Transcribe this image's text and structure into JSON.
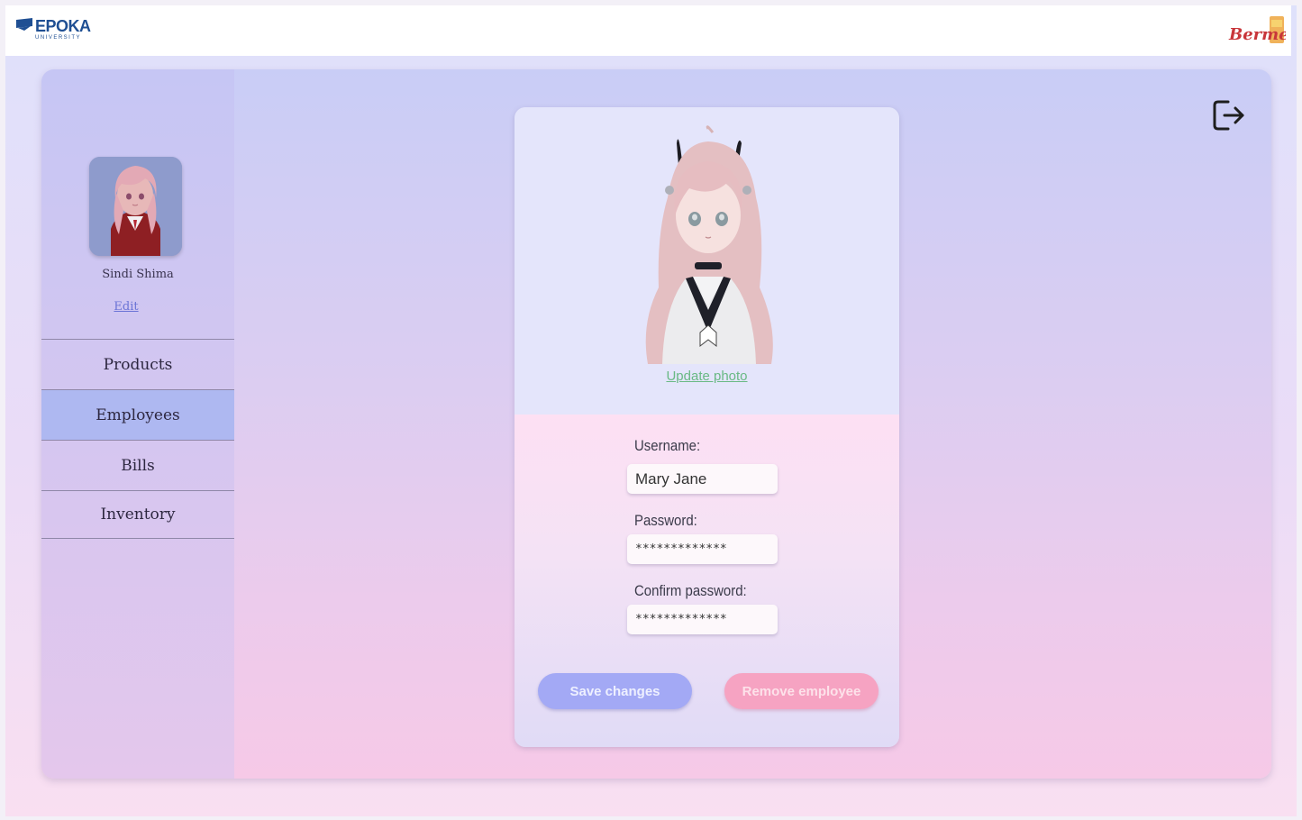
{
  "header": {
    "left_logo": {
      "name": "EPOKA",
      "subtitle": "UNIVERSITY",
      "icon": "epoka-flag-icon"
    },
    "right_logo": {
      "name": "Bermet",
      "icon": "bermet-logo-icon"
    }
  },
  "sidebar": {
    "user_name": "Sindi Shima",
    "edit_label": "Edit",
    "items": [
      {
        "label": "Products",
        "active": false
      },
      {
        "label": "Employees",
        "active": true
      },
      {
        "label": "Bills",
        "active": false
      },
      {
        "label": "Inventory",
        "active": false
      }
    ]
  },
  "toolbar": {
    "logout_icon": "logout-icon"
  },
  "employee": {
    "update_photo_label": "Update photo",
    "username_label": "Username:",
    "username_value": "Mary Jane",
    "password_label": "Password:",
    "password_value": "*************",
    "confirm_label": "Confirm password:",
    "confirm_value": "*************",
    "save_label": "Save changes",
    "remove_label": "Remove employee"
  },
  "colors": {
    "active_nav": "#aeb8f1",
    "save_button": "#a3a9f5",
    "remove_button": "#f6a3c2",
    "link_green": "#69b984",
    "link_blue": "#6b74d6"
  }
}
